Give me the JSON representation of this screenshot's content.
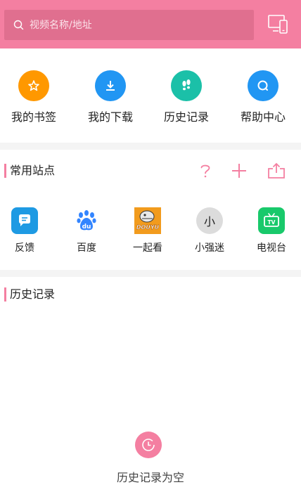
{
  "colors": {
    "brand": "#f47fa1",
    "bookmark": "#ff9800",
    "download": "#2196f3",
    "history": "#1bc0a8",
    "help": "#2196f3"
  },
  "search": {
    "placeholder": "视频名称/地址"
  },
  "quick_actions": [
    {
      "label": "我的书签",
      "icon": "star-icon"
    },
    {
      "label": "我的下载",
      "icon": "download-icon"
    },
    {
      "label": "历史记录",
      "icon": "footprint-icon"
    },
    {
      "label": "帮助中心",
      "icon": "help-icon"
    }
  ],
  "sites_section": {
    "title": "常用站点",
    "actions": [
      "help-icon",
      "add-icon",
      "share-icon"
    ],
    "items": [
      {
        "label": "反馈",
        "icon": "message-icon"
      },
      {
        "label": "百度",
        "icon": "baidu-paw-icon"
      },
      {
        "label": "一起看",
        "icon": "shark-logo-icon",
        "logo_text": "DOUYU"
      },
      {
        "label": "小强迷",
        "icon": "avatar-icon",
        "avatar_text": "小"
      },
      {
        "label": "电视台",
        "icon": "tv-icon",
        "logo_text": "TV"
      }
    ]
  },
  "history_section": {
    "title": "历史记录",
    "empty_text": "历史记录为空"
  }
}
